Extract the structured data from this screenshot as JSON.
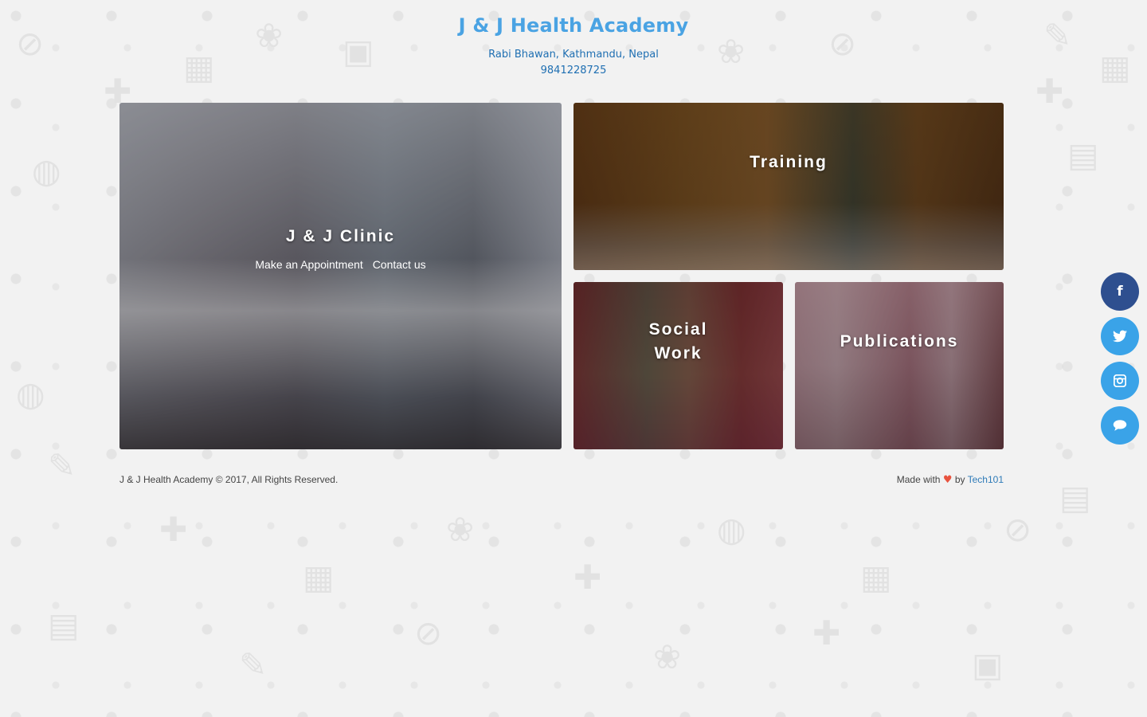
{
  "header": {
    "title": "J & J Health Academy",
    "address": "Rabi Bhawan, Kathmandu, Nepal",
    "phone": "9841228725"
  },
  "tiles": {
    "clinic": {
      "title": "J & J Clinic",
      "links": [
        "Make an Appointment",
        "Contact us"
      ]
    },
    "training": {
      "title": "Training"
    },
    "social": {
      "title_line1": "Social",
      "title_line2": "Work"
    },
    "publications": {
      "title": "Publications"
    }
  },
  "footer": {
    "copyright": "J & J Health Academy © 2017, All Rights Reserved.",
    "made_with": "Made with",
    "by": "by",
    "author": "Tech101"
  },
  "social": {
    "icons": [
      "facebook-icon",
      "twitter-icon",
      "instagram-icon",
      "chat-icon"
    ],
    "facebook_glyph": "f",
    "twitter_glyph": "🐦",
    "instagram_glyph": "◎",
    "chat_glyph": "●",
    "colors": {
      "facebook": "#2e4f8f",
      "default": "#3aa3e8"
    }
  },
  "colors": {
    "title": "#4aa3e3",
    "subtitle": "#1f6fb2",
    "heart": "#e8533f",
    "link": "#2f7bb8"
  }
}
